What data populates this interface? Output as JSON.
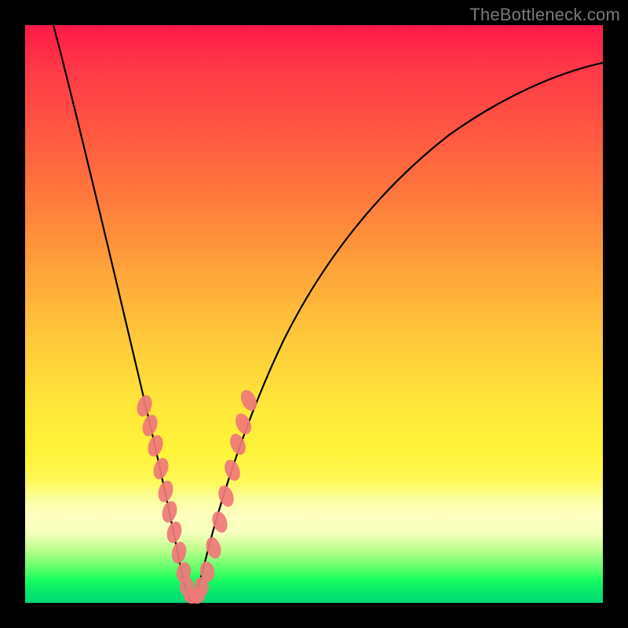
{
  "watermark": {
    "text": "TheBottleneck.com"
  },
  "colors": {
    "curve": "#000000",
    "marker": "#f07878",
    "frame": "#000000"
  },
  "chart_data": {
    "type": "line",
    "title": "",
    "xlabel": "",
    "ylabel": "",
    "xlim": [
      0,
      100
    ],
    "ylim": [
      0,
      100
    ],
    "grid": false,
    "note": "No axis ticks or numeric labels are shown; x/y values are estimated in percent of plot width/height with y=0 at bottom.",
    "series": [
      {
        "name": "bottleneck-curve",
        "x": [
          5,
          8,
          12,
          16,
          20,
          22,
          24,
          26,
          27,
          28.5,
          30,
          32,
          34,
          37,
          40,
          44,
          48,
          54,
          60,
          68,
          78,
          88,
          98
        ],
        "y": [
          100,
          86,
          70,
          54,
          37,
          28,
          18,
          9,
          3,
          0,
          3,
          10,
          18,
          28,
          37,
          46,
          54,
          63,
          70,
          77,
          83,
          87,
          90
        ]
      }
    ],
    "markers": {
      "name": "highlighted-points",
      "description": "Salmon capsule markers clustered along the lower V of the curve",
      "x": [
        20.5,
        21.5,
        22.5,
        23.5,
        24.3,
        25.0,
        25.8,
        26.6,
        27.4,
        28.0,
        28.7,
        29.3,
        30.0,
        30.8,
        31.6,
        32.4,
        33.3,
        34.2,
        35.2,
        36.0,
        37.0
      ],
      "y": [
        34.0,
        30.5,
        27.0,
        23.0,
        19.0,
        15.5,
        12.0,
        8.5,
        5.2,
        2.8,
        1.2,
        1.2,
        2.8,
        5.5,
        9.5,
        14.0,
        18.5,
        23.0,
        27.5,
        31.0,
        35.0
      ]
    }
  }
}
